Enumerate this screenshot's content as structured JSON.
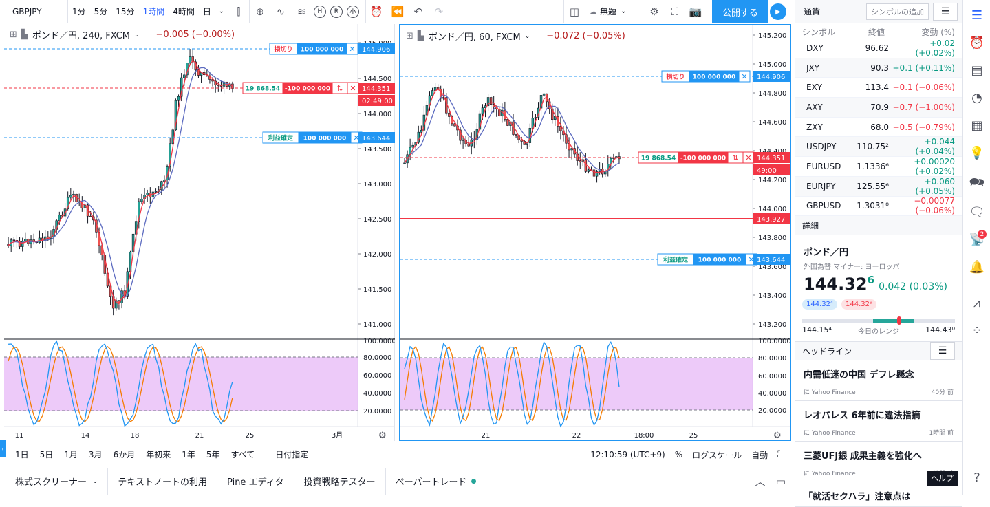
{
  "toolbar": {
    "symbol": "GBPJPY",
    "intervals": [
      "1分",
      "5分",
      "15分",
      "1時間",
      "4時間",
      "日"
    ],
    "active_interval": "1時間",
    "indicator_h": "H",
    "indicator_r": "R",
    "indicator_small": "小",
    "layout_name": "無題",
    "publish_label": "公開する"
  },
  "left_chart": {
    "title": "ポンド／円, 240, FXCM",
    "change": "−0.005 (−0.00%)",
    "price_ticks": [
      "145.000",
      "144.500",
      "144.000",
      "143.500",
      "143.000",
      "142.500",
      "142.000",
      "141.500",
      "141.000"
    ],
    "osc_ticks": [
      "100.0000",
      "80.0000",
      "60.0000",
      "40.0000",
      "20.0000"
    ],
    "date_ticks": [
      "11",
      "14",
      "18",
      "21",
      "25",
      "3月"
    ],
    "stop_label": "損切り",
    "stop_qty": "100 000 000",
    "stop_price": "144.906",
    "pos_pnl": "19 868.54",
    "pos_qty": "-100 000 000",
    "pos_price": "144.351",
    "countdown": "02:49:00",
    "tp_label": "利益確定",
    "tp_qty": "100 000 000",
    "tp_price": "143.644"
  },
  "right_chart": {
    "title": "ポンド／円, 60, FXCM",
    "change": "−0.072 (−0.05%)",
    "price_ticks": [
      "145.200",
      "145.000",
      "144.800",
      "144.600",
      "144.400",
      "144.200",
      "144.000",
      "143.800",
      "143.600",
      "143.400",
      "143.200"
    ],
    "osc_ticks": [
      "100.0000",
      "80.0000",
      "60.0000",
      "40.0000",
      "20.0000"
    ],
    "date_ticks": [
      "21",
      "22",
      "18:00",
      "25"
    ],
    "stop_label": "損切り",
    "stop_qty": "100 000 000",
    "stop_price": "144.906",
    "pos_pnl": "19 868.54",
    "pos_qty": "-100 000 000",
    "pos_price": "144.351",
    "countdown": "49:00",
    "hline_price": "143.927",
    "tp_label": "利益確定",
    "tp_qty": "100 000 000",
    "tp_price": "143.644"
  },
  "bottom_bar": {
    "ranges": [
      "1日",
      "5日",
      "1月",
      "3月",
      "6か月",
      "年初来",
      "1年",
      "5年",
      "すべて"
    ],
    "goto_date": "日付指定",
    "clock": "12:10:59 (UTC+9)",
    "percent": "%",
    "log": "ログスケール",
    "auto": "自動"
  },
  "footer_tabs": [
    "株式スクリーナー",
    "テキストノートの利用",
    "Pine エディタ",
    "投資戦略テスター",
    "ペーパートレード"
  ],
  "watchlist": {
    "header": "通貨",
    "add_symbol": "シンボルの追加",
    "columns": {
      "symbol": "シンボル",
      "last": "終値",
      "change": "変動 (%)"
    },
    "rows": [
      {
        "symbol": "DXY",
        "last": "96.62",
        "change": "+0.02 (+0.02%)",
        "dir": "up"
      },
      {
        "symbol": "JXY",
        "last": "90.3",
        "change": "+0.1 (+0.11%)",
        "dir": "up"
      },
      {
        "symbol": "EXY",
        "last": "113.4",
        "change": "−0.1 (−0.06%)",
        "dir": "down"
      },
      {
        "symbol": "AXY",
        "last": "70.9",
        "change": "−0.7 (−1.00%)",
        "dir": "down"
      },
      {
        "symbol": "ZXY",
        "last": "68.0",
        "change": "−0.5 (−0.79%)",
        "dir": "down"
      },
      {
        "symbol": "USDJPY",
        "last": "110.75²",
        "change": "+0.044 (+0.04%)",
        "dir": "up"
      },
      {
        "symbol": "EURUSD",
        "last": "1.1336⁶",
        "change": "+0.00020 (+0.02%)",
        "dir": "up"
      },
      {
        "symbol": "EURJPY",
        "last": "125.55⁶",
        "change": "+0.060 (+0.05%)",
        "dir": "up"
      },
      {
        "symbol": "GBPUSD",
        "last": "1.3031⁸",
        "change": "−0.00077 (−0.06%)",
        "dir": "down"
      }
    ]
  },
  "details": {
    "header": "詳細",
    "name": "ポンド／円",
    "subtitle": "外国為替 マイナー: ヨーロッパ",
    "price": "144.32",
    "price_sup": "6",
    "change": "0.042 (0.03%)",
    "bid": "144.32⁴",
    "ask": "144.32⁹",
    "range_low": "144.15⁴",
    "range_label": "今日のレンジ",
    "range_high": "144.43⁰"
  },
  "headlines": {
    "header": "ヘッドライン",
    "items": [
      {
        "title": "内需低迷の中国 デフレ懸念",
        "source": "に Yahoo Finance",
        "time": "40分 前"
      },
      {
        "title": "レオパレス 6年前に違法指摘",
        "source": "に Yahoo Finance",
        "time": "1時間 前"
      },
      {
        "title": "三菱UFJ銀 成果主義を強化へ",
        "source": "に Yahoo Finance",
        "time": "3時間 前"
      },
      {
        "title": "「就活セクハラ」注意点は",
        "source": "",
        "time": ""
      }
    ]
  },
  "rail": {
    "badge": "2",
    "help": "ヘルプ"
  },
  "colors": {
    "accent": "#2196f3",
    "up": "#089981",
    "down": "#f23645",
    "osc_band": "#e6b3f7"
  }
}
